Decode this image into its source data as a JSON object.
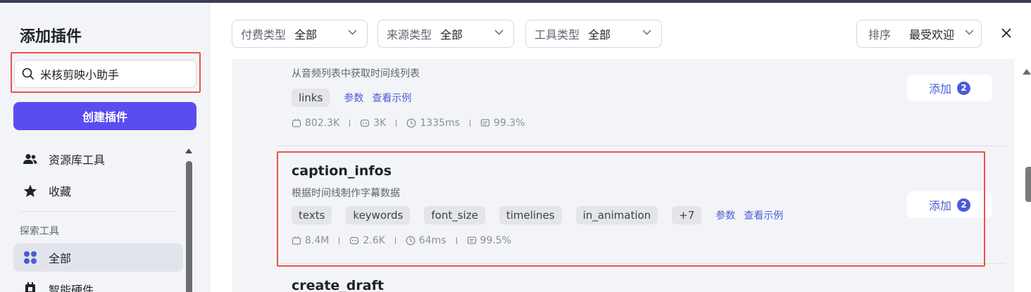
{
  "sidebar": {
    "title": "添加插件",
    "search_value": "米核剪映小助手",
    "create_button": "创建插件",
    "nav_items": [
      {
        "label": "资源库工具",
        "icon": "users-icon"
      },
      {
        "label": "收藏",
        "icon": "star-icon"
      }
    ],
    "section_label": "探索工具",
    "explore_items": [
      {
        "label": "全部",
        "icon": "grid-icon",
        "active": true
      },
      {
        "label": "智能硬件",
        "icon": "chip-icon"
      }
    ]
  },
  "filters": [
    {
      "label": "付费类型",
      "value": "全部"
    },
    {
      "label": "来源类型",
      "value": "全部"
    },
    {
      "label": "工具类型",
      "value": "全部"
    }
  ],
  "sort": {
    "label": "排序",
    "value": "最受欢迎"
  },
  "plugins": [
    {
      "title": "",
      "description": "从音频列表中获取时间线列表",
      "tags": [
        "links"
      ],
      "links": [
        "参数",
        "查看示例"
      ],
      "stats": {
        "uses": "802.3K",
        "bots": "3K",
        "latency": "1335ms",
        "success": "99.3%"
      },
      "add_label": "添加",
      "add_count": "2"
    },
    {
      "title": "caption_infos",
      "description": "根据时间线制作字幕数据",
      "tags": [
        "texts",
        "keywords",
        "font_size",
        "timelines",
        "in_animation",
        "+7"
      ],
      "links": [
        "参数",
        "查看示例"
      ],
      "stats": {
        "uses": "8.4M",
        "bots": "2.6K",
        "latency": "64ms",
        "success": "99.5%"
      },
      "add_label": "添加",
      "add_count": "2"
    },
    {
      "title": "create_draft",
      "description": "",
      "tags": [],
      "links": [],
      "stats": {},
      "add_label": "",
      "add_count": ""
    }
  ],
  "colors": {
    "accent": "#5a4df0",
    "link": "#4c5bd4",
    "highlight": "#e8534f"
  }
}
